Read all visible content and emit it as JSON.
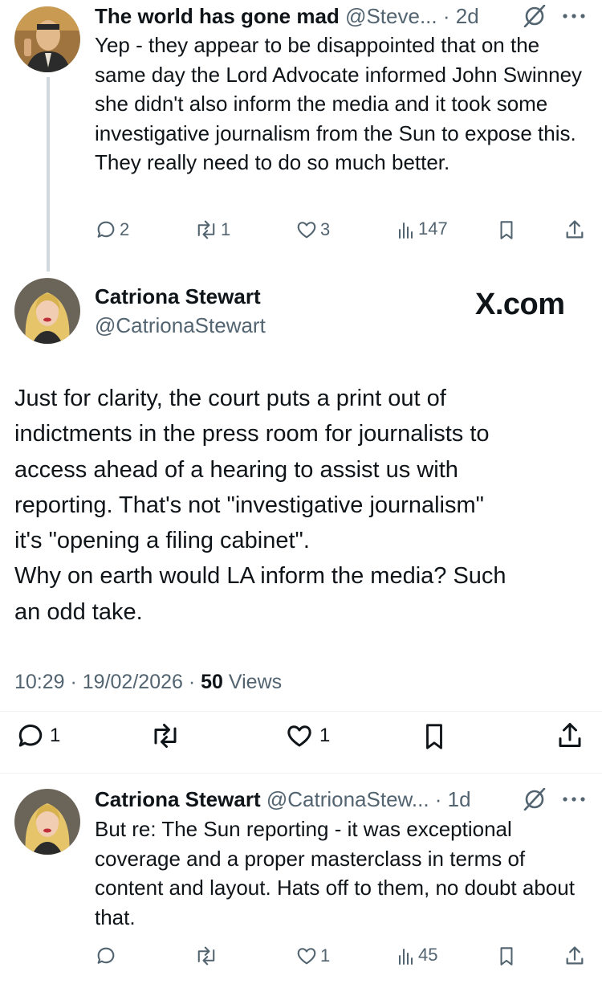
{
  "reply1": {
    "name": "The world has gone mad",
    "handle": "@Steve...",
    "time": "· 2d",
    "text": "Yep - they appear to be disappointed that on the same day the Lord Advocate informed John Swinney she didn't also inform the media and it took some investigative journalism from the Sun to expose this. They really need to do so much better.",
    "replies": "2",
    "reposts": "1",
    "likes": "3",
    "views": "147"
  },
  "main": {
    "name": "Catriona Stewart",
    "handle": "@CatrionaStewart",
    "watermark": "X.com",
    "text_lines": [
      "Just for clarity, the court puts a print out of",
      "indictments in the press room for journalists to",
      "access ahead of a hearing to assist us with",
      "reporting. That's not \"investigative journalism\"",
      "it's \"opening a filing cabinet\".",
      "Why on earth would LA inform the media? Such",
      "an odd take."
    ],
    "timestamp": "10:29 · 19/02/2026 ·",
    "views_count": "50",
    "views_label": "Views",
    "replies": "1",
    "likes": "1"
  },
  "reply2": {
    "name": "Catriona Stewart",
    "handle": "@CatrionaStew...",
    "time": "· 1d",
    "text": "But re: The Sun reporting - it was exceptional coverage and a proper masterclass in terms of content and layout. Hats off to them, no doubt about that.",
    "likes": "1",
    "views": "45"
  },
  "colors": {
    "text": "#0f1419",
    "muted": "#536471",
    "divider": "#eff3f4",
    "thread_line": "#cfd9de"
  }
}
